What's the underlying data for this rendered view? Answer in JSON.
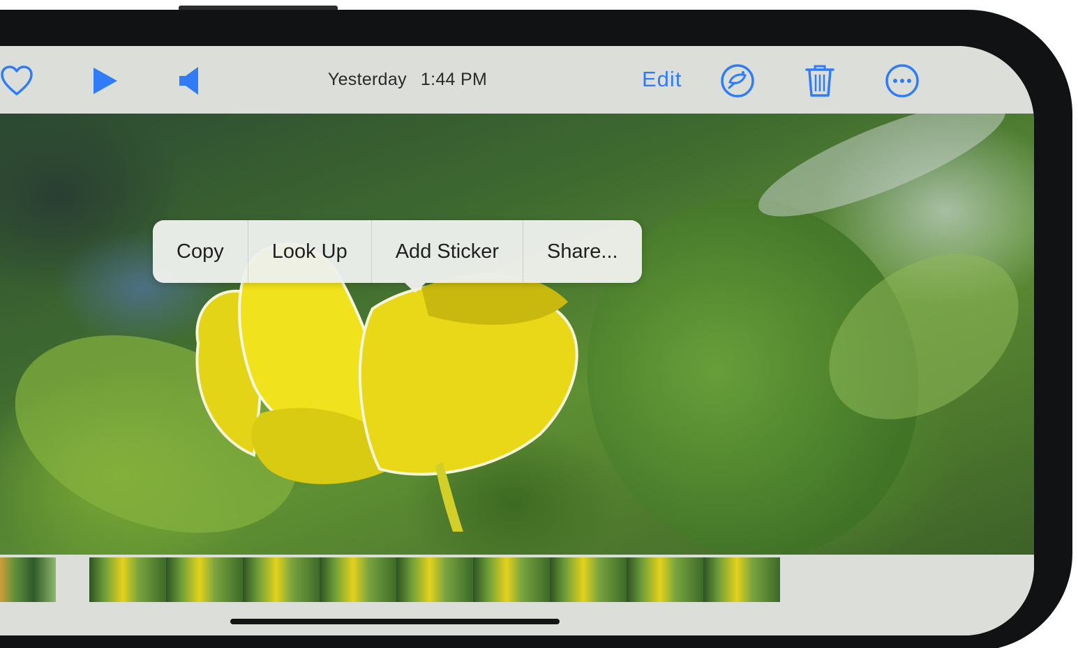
{
  "toolbar": {
    "icons": {
      "favorite": "heart-icon",
      "play": "play-icon",
      "sound": "speaker-icon",
      "visual_lookup": "visual-lookup-icon",
      "delete": "trash-icon",
      "more": "ellipsis-circle-icon"
    },
    "date": "Yesterday",
    "time": "1:44 PM",
    "edit_label": "Edit",
    "accent_color": "#2f7cf6"
  },
  "context_menu": {
    "items": [
      "Copy",
      "Look Up",
      "Add Sticker",
      "Share..."
    ]
  },
  "filmstrip": {
    "thumbnail_count": 9
  }
}
